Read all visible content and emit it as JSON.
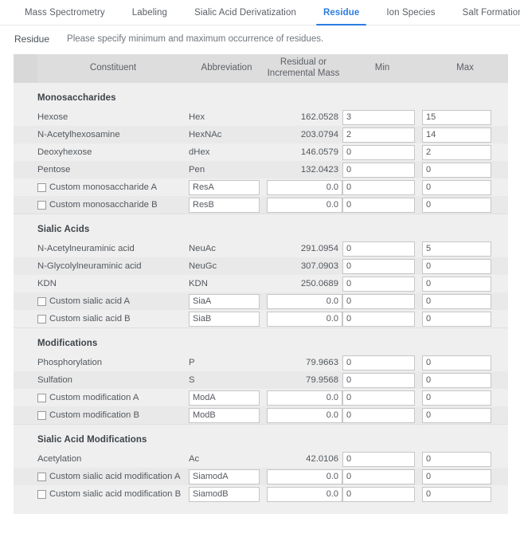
{
  "tabs": [
    {
      "label": "Mass Spectrometry",
      "active": false
    },
    {
      "label": "Labeling",
      "active": false
    },
    {
      "label": "Sialic Acid Derivatization",
      "active": false
    },
    {
      "label": "Residue",
      "active": true
    },
    {
      "label": "Ion Species",
      "active": false
    },
    {
      "label": "Salt Formation",
      "active": false
    }
  ],
  "page": {
    "title": "Residue",
    "description": "Please specify minimum and maximum occurrence of residues."
  },
  "table": {
    "headers": {
      "spacer": "",
      "constituent": "Constituent",
      "abbreviation": "Abbreviation",
      "mass_line1": "Residual or",
      "mass_line2": "Incremental Mass",
      "min": "Min",
      "max": "Max"
    }
  },
  "colors": {
    "accent": "#2b7de0",
    "header_bg": "#dddddd",
    "panel_bg": "#efefef",
    "row_alt_bg": "#e9e9e9"
  },
  "sections": [
    {
      "title": "Monosaccharides",
      "rows": [
        {
          "type": "fixed",
          "name": "Hexose",
          "abbr": "Hex",
          "mass": "162.0528",
          "min": "3",
          "max": "15",
          "alt": false
        },
        {
          "type": "fixed",
          "name": "N-Acetylhexosamine",
          "abbr": "HexNAc",
          "mass": "203.0794",
          "min": "2",
          "max": "14",
          "alt": true
        },
        {
          "type": "fixed",
          "name": "Deoxyhexose",
          "abbr": "dHex",
          "mass": "146.0579",
          "min": "0",
          "max": "2",
          "alt": false
        },
        {
          "type": "fixed",
          "name": "Pentose",
          "abbr": "Pen",
          "mass": "132.0423",
          "min": "0",
          "max": "0",
          "alt": true
        },
        {
          "type": "custom",
          "name": "Custom monosaccharide A",
          "abbr": "ResA",
          "mass": "0.0",
          "min": "0",
          "max": "0",
          "alt": false,
          "checked": false
        },
        {
          "type": "custom",
          "name": "Custom monosaccharide B",
          "abbr": "ResB",
          "mass": "0.0",
          "min": "0",
          "max": "0",
          "alt": true,
          "checked": false
        }
      ]
    },
    {
      "title": "Sialic Acids",
      "rows": [
        {
          "type": "fixed",
          "name": "N-Acetylneuraminic acid",
          "abbr": "NeuAc",
          "mass": "291.0954",
          "min": "0",
          "max": "5",
          "alt": false
        },
        {
          "type": "fixed",
          "name": "N-Glycolylneuraminic acid",
          "abbr": "NeuGc",
          "mass": "307.0903",
          "min": "0",
          "max": "0",
          "alt": true
        },
        {
          "type": "fixed",
          "name": "KDN",
          "abbr": "KDN",
          "mass": "250.0689",
          "min": "0",
          "max": "0",
          "alt": false
        },
        {
          "type": "custom",
          "name": "Custom sialic acid A",
          "abbr": "SiaA",
          "mass": "0.0",
          "min": "0",
          "max": "0",
          "alt": true,
          "checked": false
        },
        {
          "type": "custom",
          "name": "Custom sialic acid B",
          "abbr": "SiaB",
          "mass": "0.0",
          "min": "0",
          "max": "0",
          "alt": false,
          "checked": false
        }
      ]
    },
    {
      "title": "Modifications",
      "rows": [
        {
          "type": "fixed",
          "name": "Phosphorylation",
          "abbr": "P",
          "mass": "79.9663",
          "min": "0",
          "max": "0",
          "alt": false
        },
        {
          "type": "fixed",
          "name": "Sulfation",
          "abbr": "S",
          "mass": "79.9568",
          "min": "0",
          "max": "0",
          "alt": true
        },
        {
          "type": "custom",
          "name": "Custom modification A",
          "abbr": "ModA",
          "mass": "0.0",
          "min": "0",
          "max": "0",
          "alt": false,
          "checked": false
        },
        {
          "type": "custom",
          "name": "Custom modification B",
          "abbr": "ModB",
          "mass": "0.0",
          "min": "0",
          "max": "0",
          "alt": true,
          "checked": false
        }
      ]
    },
    {
      "title": "Sialic Acid Modifications",
      "rows": [
        {
          "type": "fixed",
          "name": "Acetylation",
          "abbr": "Ac",
          "mass": "42.0106",
          "min": "0",
          "max": "0",
          "alt": false
        },
        {
          "type": "custom",
          "name": "Custom sialic acid modification A",
          "abbr": "SiamodA",
          "mass": "0.0",
          "min": "0",
          "max": "0",
          "alt": true,
          "checked": false
        },
        {
          "type": "custom",
          "name": "Custom sialic acid modification B",
          "abbr": "SiamodB",
          "mass": "0.0",
          "min": "0",
          "max": "0",
          "alt": false,
          "checked": false
        }
      ]
    }
  ]
}
